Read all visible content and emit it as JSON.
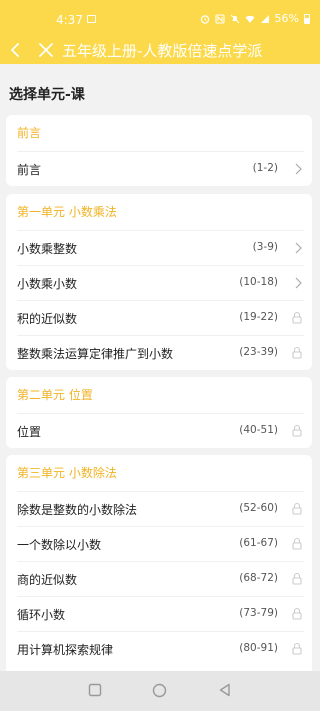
{
  "status": {
    "time": "4:37",
    "battery": "56%"
  },
  "nav": {
    "title": "五年级上册-人教版倍速点学派"
  },
  "page_heading": "选择单元-课",
  "sections": [
    {
      "title": "前言",
      "items": [
        {
          "label": "前言",
          "pages": "(1-2)",
          "locked": false
        }
      ]
    },
    {
      "title": "第一单元  小数乘法",
      "items": [
        {
          "label": "小数乘整数",
          "pages": "(3-9)",
          "locked": false
        },
        {
          "label": "小数乘小数",
          "pages": "(10-18)",
          "locked": false
        },
        {
          "label": "积的近似数",
          "pages": "(19-22)",
          "locked": true
        },
        {
          "label": "整数乘法运算定律推广到小数",
          "pages": "(23-39)",
          "locked": true
        }
      ]
    },
    {
      "title": "第二单元  位置",
      "items": [
        {
          "label": "位置",
          "pages": "(40-51)",
          "locked": true
        }
      ]
    },
    {
      "title": "第三单元  小数除法",
      "items": [
        {
          "label": "除数是整数的小数除法",
          "pages": "(52-60)",
          "locked": true
        },
        {
          "label": "一个数除以小数",
          "pages": "(61-67)",
          "locked": true
        },
        {
          "label": "商的近似数",
          "pages": "(68-72)",
          "locked": true
        },
        {
          "label": "循环小数",
          "pages": "(73-79)",
          "locked": true
        },
        {
          "label": "用计算机探索规律",
          "pages": "(80-91)",
          "locked": true
        }
      ]
    }
  ],
  "colors": {
    "accent": "#fcd94a",
    "section_title": "#f0b324"
  }
}
